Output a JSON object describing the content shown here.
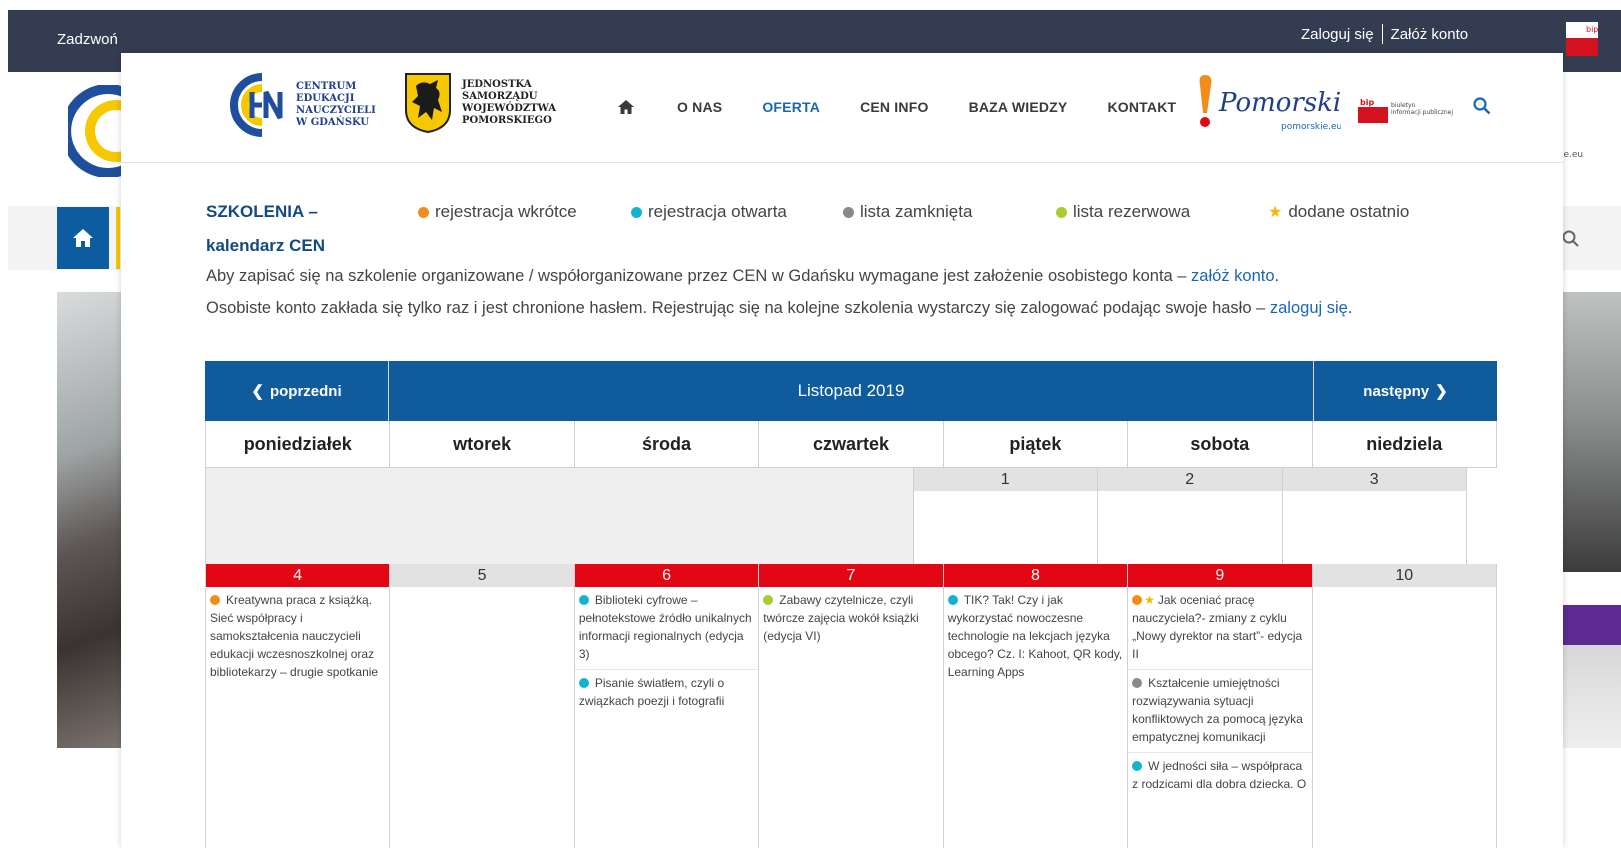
{
  "background": {
    "topbar": {
      "call_text": "Zadzwoń",
      "login": "Zaloguj się",
      "register": "Załóż konto"
    },
    "right_logo_text": "ie.eu"
  },
  "header": {
    "cen_logo_lines": [
      "CENTRUM",
      "EDUKACJI",
      "NAUCZYCIELI",
      "W GDAŃSKU"
    ],
    "jst_logo_lines": [
      "JEDNOSTKA",
      "SAMORZĄDU",
      "WOJEWÓDZTWA",
      "POMORSKIEGO"
    ],
    "menu": [
      "O NAS",
      "OFERTA",
      "CEN INFO",
      "BAZA WIEDZY",
      "KONTAKT"
    ],
    "active_menu": "OFERTA",
    "pomorskie_script": "Pomorskie",
    "pomorskie_url": "pomorskie.eu",
    "bip_label": "bip",
    "bip_lines": [
      "biuletyn",
      "informacji publicznej"
    ]
  },
  "content": {
    "title_line1": "SZKOLENIA –",
    "title_line2": "kalendarz CEN",
    "legend": [
      {
        "label": "rejestracja wkrótce",
        "color": "#f28c1a"
      },
      {
        "label": "rejestracja otwarta",
        "color": "#13b3d0"
      },
      {
        "label": "lista zamknięta",
        "color": "#8a8a8a"
      },
      {
        "label": "lista rezerwowa",
        "color": "#a6cf2b"
      },
      {
        "label": "dodane ostatnio",
        "color": "#f5b800"
      }
    ],
    "info1_text": "Aby zapisać się na szkolenie organizowane  / współorganizowane przez CEN w Gdańsku wymagane jest założenie osobistego konta – ",
    "info1_link": "załóż konto",
    "info1_end": ".",
    "info2_text": "Osobiste konto zakłada się tylko raz i jest chronione hasłem. Rejestrując się na kolejne szkolenia wystarczy się zalogować podając swoje hasło – ",
    "info2_link": "zaloguj się",
    "info2_end": "."
  },
  "calendar": {
    "prev": "poprzedni",
    "next": "następny",
    "month": "Listopad 2019",
    "days": [
      "poniedziałek",
      "wtorek",
      "środa",
      "czwartek",
      "piątek",
      "sobota",
      "niedziela"
    ],
    "week1": [
      "1",
      "2",
      "3"
    ],
    "week2_nums": [
      "4",
      "5",
      "6",
      "7",
      "8",
      "9",
      "10"
    ],
    "events": {
      "mon4": [
        "Kreatywna praca z książką. Sieć współpracy i samokształcenia nauczycieli edukacji wczesnoszkolnej oraz bibliotekarzy – drugie spotkanie"
      ],
      "wed6": [
        "Biblioteki cyfrowe – pełnotekstowe źródło unikalnych informacji regionalnych (edycja 3)",
        "Pisanie światłem, czyli o związkach poezji i fotografii"
      ],
      "thu7": [
        "Zabawy czytelnicze, czyli twórcze zajęcia wokół książki (edycja VI)"
      ],
      "fri8": [
        "TIK? Tak! Czy i jak wykorzystać nowoczesne technologie na lekcjach języka obcego? Cz. I: Kahoot, QR kody, Learning Apps"
      ],
      "sat9": [
        "Jak oceniać pracę nauczyciela?- zmiany z cyklu „Nowy dyrektor na start”- edycja II",
        "Kształcenie umiejętności rozwiązywania sytuacji konfliktowych za pomocą języka empatycznej komunikacji",
        "W jedności siła – współpraca z rodzicami dla dobra dziecka. O"
      ]
    },
    "colors": {
      "orange": "#f28c1a",
      "cyan": "#13b3d0",
      "grey": "#8a8a8a",
      "green": "#a6cf2b",
      "star": "#f5b800",
      "red": "#e30613",
      "blue": "#0f5b9c"
    }
  }
}
